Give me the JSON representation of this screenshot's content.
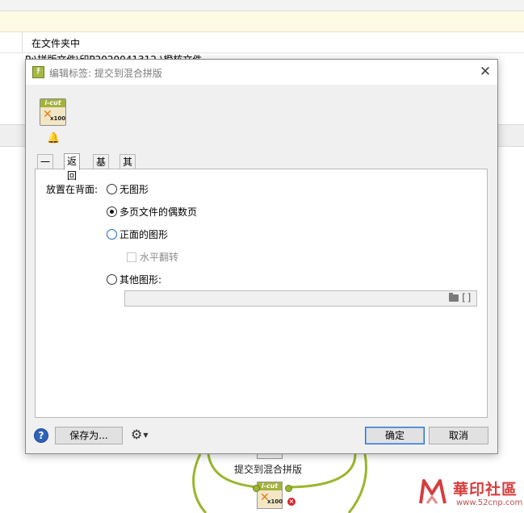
{
  "background": {
    "row1_text": "在文件夹中",
    "row2_text": "P:\\拼版文件\\印P2020041312-\\橙核文件",
    "flow_label": "提交到混合拼版"
  },
  "watermark": {
    "text": "華印社區",
    "url": "www.52cnp.com"
  },
  "dialog": {
    "title": "编辑标签: 提交到混合拼版",
    "close_symbol": "✕",
    "badge": {
      "top": "i-cut",
      "bottom": "x100"
    },
    "bell_symbol": "🔔",
    "tabs": [
      {
        "label": "一般",
        "active": false
      },
      {
        "label": "返回",
        "active": true
      },
      {
        "label": "基材",
        "active": false
      },
      {
        "label": "其他",
        "active": false
      }
    ],
    "placement_label": "放置在背面:",
    "options": [
      {
        "label": "无图形",
        "checked": false
      },
      {
        "label": "多页文件的偶数页",
        "checked": true
      },
      {
        "label": "正面的图形",
        "checked": false
      },
      {
        "label": "其他图形:",
        "checked": false
      }
    ],
    "flip_label": "水平翻转",
    "path_value": "",
    "bracket_symbol": "[]",
    "help_symbol": "?",
    "save_as_label": "保存为...",
    "gear_symbol": "⚙",
    "ok_label": "确定",
    "cancel_label": "取消"
  },
  "colors": {
    "accent": "#2a6fd1",
    "help": "#2f63b8",
    "flow": "#9ab62d",
    "error": "#d8232a",
    "watermark": "#d73d3d"
  }
}
